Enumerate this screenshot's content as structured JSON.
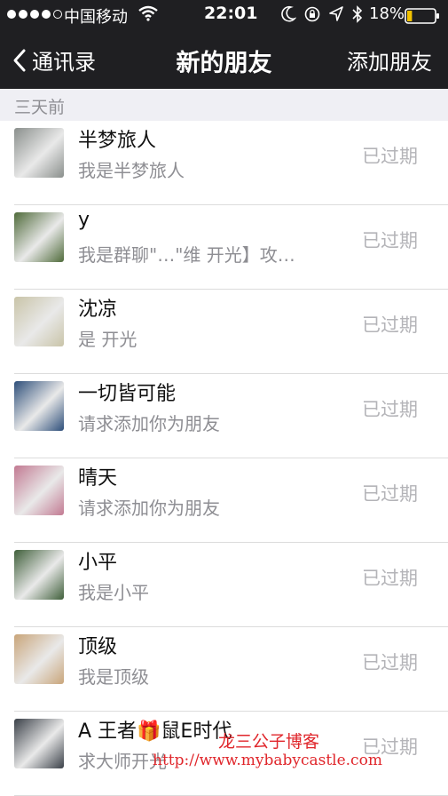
{
  "status_bar": {
    "carrier": "中国移动",
    "time": "22:01",
    "battery_percent": "18%",
    "battery_level": 0.18,
    "signal_bars": 4
  },
  "nav": {
    "back_label": "通讯录",
    "title": "新的朋友",
    "action_label": "添加朋友"
  },
  "section": {
    "header": "三天前"
  },
  "friends": [
    {
      "name": "半梦旅人",
      "message": "我是半梦旅人",
      "status": "已过期",
      "avatar_color": "#8a8f8c"
    },
    {
      "name": "y",
      "message": "我是群聊\"…\"维 开光】攻…",
      "status": "已过期",
      "avatar_color": "#4f6b3a"
    },
    {
      "name": "沈凉",
      "message": "是 开光",
      "status": "已过期",
      "avatar_color": "#c9c4a8"
    },
    {
      "name": "一切皆可能",
      "message": "请求添加你为朋友",
      "status": "已过期",
      "avatar_color": "#2d4e7a"
    },
    {
      "name": "晴天",
      "message": "请求添加你为朋友",
      "status": "已过期",
      "avatar_color": "#c27a92"
    },
    {
      "name": "小平",
      "message": "我是小平",
      "status": "已过期",
      "avatar_color": "#3f5f3a"
    },
    {
      "name": "顶级",
      "message": "我是顶级",
      "status": "已过期",
      "avatar_color": "#c9a57a"
    },
    {
      "name": "A 王者🎁鼠E时代",
      "message": "求大师开光",
      "status": "已过期",
      "avatar_color": "#3a4048"
    }
  ],
  "watermark": {
    "title": "龙三公子博客",
    "url": "http://www.mybabycastle.com"
  },
  "colors": {
    "bar_background": "#1f1f22",
    "section_background": "#efeff4",
    "status_text": "#b4b4b8",
    "watermark": "#e0262b"
  }
}
